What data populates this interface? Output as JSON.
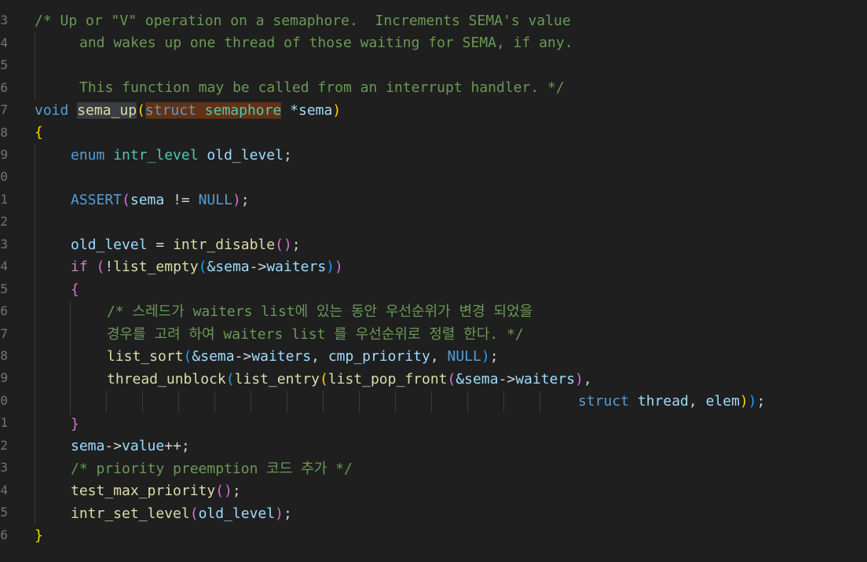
{
  "gutter": {
    "line_numbers": [
      "3",
      "4",
      "5",
      "6",
      "7",
      "8",
      "9",
      "0",
      "1",
      "2",
      "3",
      "4",
      "5",
      "6",
      "7",
      "8",
      "9",
      "0",
      "1",
      "2",
      "3",
      "4",
      "5",
      "6"
    ]
  },
  "code": {
    "comment_1a": "/* Up or \"V\" operation on a semaphore.  Increments SEMA's value",
    "comment_1b": "and wakes up one thread of those waiting for SEMA, if any.",
    "comment_1c": "This function may be called from an interrupt handler. */",
    "kw_void": "void",
    "fn_sema_up": "sema_up",
    "kw_struct": "struct",
    "ty_semaphore": "semaphore",
    "star_sema": "*sema",
    "kw_enum": "enum",
    "ty_intr_level": "intr_level",
    "var_old_level": "old_level",
    "fn_assert": "ASSERT",
    "var_sema": "sema",
    "op_neq": " != ",
    "kw_null": "NULL",
    "fn_intr_disable": "intr_disable",
    "kw_if": "if",
    "fn_list_empty": "list_empty",
    "var_amp_sema": "&sema",
    "arrow": "->",
    "var_waiters": "waiters",
    "comment_2a": "/* 스레드가 waiters list에 있는 동안 우선순위가 변경 되었을",
    "comment_2b": "경우를 고려 하여 waiters list 를 우선순위로 정렬 한다. */",
    "fn_list_sort": "list_sort",
    "var_cmp_priority": "cmp_priority",
    "fn_thread_unblock": "thread_unblock",
    "fn_list_entry": "list_entry",
    "fn_list_pop_front": "list_pop_front",
    "var_thread": "thread",
    "var_elem": "elem",
    "var_value": "value",
    "op_inc": "++",
    "comment_3": "/* priority preemption 코드 추가 */",
    "fn_test_max_priority": "test_max_priority",
    "fn_intr_set_level": "intr_set_level"
  },
  "colors": {
    "background": "#1f1f1f",
    "keyword": "#569cd6",
    "function": "#dcdcaa",
    "type": "#4ec9b0",
    "variable": "#9cdcfe",
    "comment": "#6a9955",
    "control": "#c586c0",
    "bracket_gold": "#ffd700",
    "bracket_orchid": "#da70d6",
    "bracket_blue": "#179fff"
  }
}
